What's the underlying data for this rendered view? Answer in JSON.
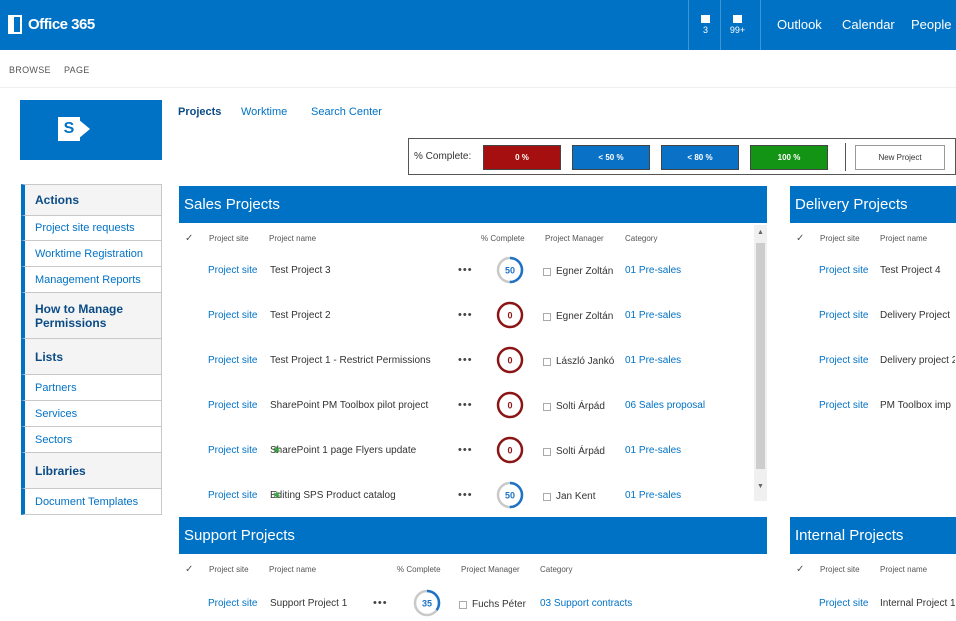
{
  "suite": {
    "brand": "Office 365",
    "mail_count": "3",
    "calendar_count": "99+",
    "nav": [
      "Outlook",
      "Calendar",
      "People"
    ]
  },
  "ribbon": {
    "browse": "BROWSE",
    "page": "PAGE"
  },
  "site_logo_letter": "S",
  "top_nav": [
    "Projects",
    "Worktime",
    "Search Center"
  ],
  "filter": {
    "label": "% Complete:",
    "buttons": [
      {
        "label": "0 %",
        "color": "#a50f0f"
      },
      {
        "label": "< 50 %",
        "color": "#0a72c6"
      },
      {
        "label": "< 80 %",
        "color": "#0a72c6"
      },
      {
        "label": "100 %",
        "color": "#149414"
      }
    ],
    "new_project": "New Project"
  },
  "quick_launch": [
    {
      "label": "Actions",
      "head": true
    },
    {
      "label": "Project site requests"
    },
    {
      "label": "Worktime Registration"
    },
    {
      "label": "Management Reports"
    },
    {
      "label": "How to Manage Permissions",
      "head": true
    },
    {
      "label": "Lists",
      "head": true
    },
    {
      "label": "Partners"
    },
    {
      "label": "Services"
    },
    {
      "label": "Sectors"
    },
    {
      "label": "Libraries",
      "head": true
    },
    {
      "label": "Document Templates"
    }
  ],
  "columns": {
    "site": "Project site",
    "name": "Project name",
    "pct": "% Complete",
    "pm": "Project Manager",
    "cat": "Category"
  },
  "sales": {
    "title": "Sales Projects",
    "rows": [
      {
        "site": "Project site",
        "name": "Test Project 3",
        "pct": 50,
        "pm": "Egner Zoltán",
        "cat": "01 Pre-sales"
      },
      {
        "site": "Project site",
        "name": "Test Project 2",
        "pct": 0,
        "pm": "Egner Zoltán",
        "cat": "01 Pre-sales"
      },
      {
        "site": "Project site",
        "name": "Test Project 1 - Restrict Permissions",
        "pct": 0,
        "pm": "László Jankó",
        "cat": "01 Pre-sales"
      },
      {
        "site": "Project site",
        "name": "SharePoint PM Toolbox pilot project",
        "pct": 0,
        "pm": "Solti Árpád",
        "cat": "06 Sales proposal"
      },
      {
        "site": "Project site",
        "name": "SharePoint 1 page Flyers update",
        "pct": 0,
        "pm": "Solti Árpád",
        "cat": "01 Pre-sales",
        "gear": true
      },
      {
        "site": "Project site",
        "name": "Editing SPS Product catalog",
        "pct": 50,
        "pm": "Jan Kent",
        "cat": "01 Pre-sales",
        "gear": true
      }
    ]
  },
  "delivery": {
    "title": "Delivery Projects",
    "rows": [
      {
        "site": "Project site",
        "name": "Test Project 4"
      },
      {
        "site": "Project site",
        "name": "Delivery Project"
      },
      {
        "site": "Project site",
        "name": "Delivery project 2"
      },
      {
        "site": "Project site",
        "name": "PM Toolbox imp"
      }
    ]
  },
  "support": {
    "title": "Support Projects",
    "rows": [
      {
        "site": "Project site",
        "name": "Support Project 1",
        "pct": 35,
        "pm": "Fuchs Péter",
        "cat": "03 Support contracts"
      }
    ]
  },
  "internal": {
    "title": "Internal Projects",
    "rows": [
      {
        "site": "Project site",
        "name": "Internal Project 1"
      }
    ]
  },
  "dots": "•••"
}
